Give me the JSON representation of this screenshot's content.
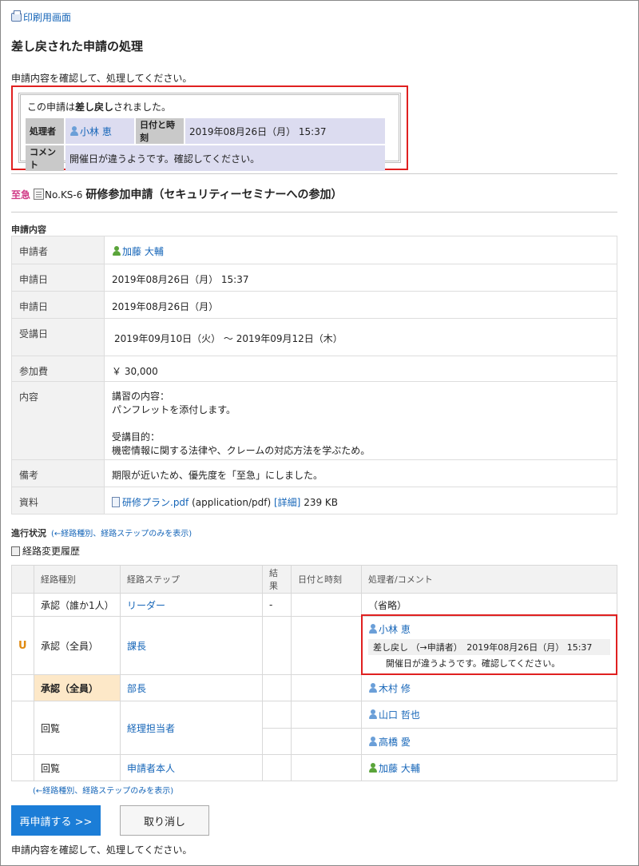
{
  "print_link": "印刷用画面",
  "page_title": "差し戻された申請の処理",
  "intro": "申請内容を確認して、処理してください。",
  "notice": {
    "msg_prefix": "この申請は",
    "msg_bold": "差し戻し",
    "msg_suffix": "されました。",
    "handler_label": "処理者",
    "handler": "小林 恵",
    "datetime_label": "日付と時刻",
    "datetime": "2019年08月26日（月） 15:37",
    "comment_label": "コメント",
    "comment": "開催日が違うようです。確認してください。"
  },
  "request": {
    "urgency": "至急",
    "number": "No.KS-6",
    "name": "研修参加申請（セキュリティーセミナーへの参加）"
  },
  "section_label": "申請内容",
  "details": {
    "applicant_label": "申請者",
    "applicant": "加藤 大輔",
    "applied_dt_label": "申請日",
    "applied_dt": "2019年08月26日（月） 15:37",
    "applied_date_label": "申請日",
    "applied_date": "2019年08月26日（月）",
    "course_label": "受講日",
    "course": "2019年09月10日（火） ～ 2019年09月12日（木）",
    "fee_label": "参加費",
    "fee": "￥ 30,000",
    "content_label": "内容",
    "content_1": "講習の内容：",
    "content_2": "パンフレットを添付します。",
    "content_3": "受講目的：",
    "content_4": "機密情報に関する法律や、クレームの対応方法を学ぶため。",
    "notes_label": "備考",
    "notes": "期限が近いため、優先度を「至急」にしました。",
    "files_label": "資料",
    "file_name": "研修プラン.pdf",
    "file_type": "(application/pdf)",
    "file_detail": "[詳細]",
    "file_size": "239 KB"
  },
  "progress": {
    "label": "進行状況",
    "link": "(←経路種別、経路ステップのみを表示)",
    "history": "経路変更履歴"
  },
  "route": {
    "headers": [
      "経路種別",
      "経路ステップ",
      "結果",
      "日付と時刻",
      "処理者/コメント"
    ],
    "r1_type": "承認（誰か1人）",
    "r1_step": "リーダー",
    "r1_result": "-",
    "r1_handler": "（省略）",
    "r2_type": "承認（全員）",
    "r2_step": "課長",
    "r2_handler": "小林 恵",
    "r2_action": "差し戻し （→申請者）　2019年08月26日（月） 15:37",
    "r2_comment": "開催日が違うようです。確認してください。",
    "r3_type": "承認（全員）",
    "r3_step": "部長",
    "r3_handler": "木村 修",
    "r4_type": "回覧",
    "r4_step": "経理担当者",
    "r4_handler_a": "山口 哲也",
    "r4_handler_b": "高橋 愛",
    "r5_type": "回覧",
    "r5_step": "申請者本人",
    "r5_handler": "加藤 大輔",
    "uturn_glyph": "U"
  },
  "bottom_link": "(←経路種別、経路ステップのみを表示)",
  "buttons": {
    "resubmit": "再申請する >>",
    "cancel": "取り消し"
  },
  "footer": "申請内容を確認して、処理してください。"
}
